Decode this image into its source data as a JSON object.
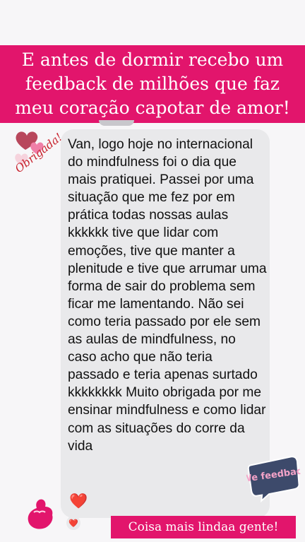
{
  "banner": {
    "headline": "E antes de dormir recebo um feedback de milhões que faz meu coração capotar de amor!"
  },
  "stickers": {
    "thanks_text": "Obrigada!",
    "feedback_text": "We feedback"
  },
  "message": {
    "text": "Van, logo hoje no internacional do mindfulness foi o dia que mais pratiquei. Passei por uma situação que me fez por em prática todas nossas aulas kkkkkk tive que lidar com emoções, tive que manter a plenitude e tive que arrumar uma forma de sair do problema sem ficar me lamentando. Não sei como teria passado por ele sem as aulas de mindfulness, no caso acho que não teria passado e teria apenas surtado kkkkkkkk Muito obrigada por me ensinar mindfulness e como lidar com as situações do corre da vida",
    "emoji": "❤️",
    "reaction": "❤️"
  },
  "caption": {
    "text": "Coisa mais lindaa gente!"
  },
  "colors": {
    "brand_pink": "#e2156c",
    "bubble_gray": "#e9e9eb",
    "heart_red": "#e0171f"
  }
}
